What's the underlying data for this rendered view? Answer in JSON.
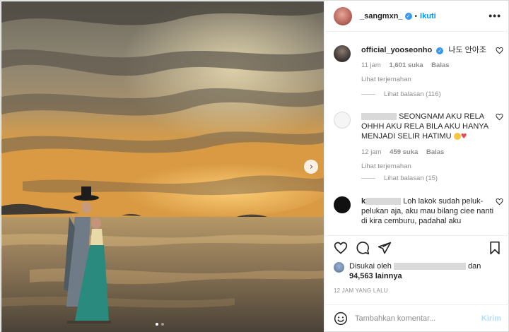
{
  "post": {
    "author": "_sangmxn_",
    "dot": "•",
    "follow_label": "Ikuti",
    "more_label": "•••"
  },
  "comments": [
    {
      "user": "official_yooseonho",
      "text": "나도 안아조",
      "time": "11 jam",
      "likes": "1,601 suka",
      "reply_label": "Balas",
      "translate_label": "Lihat terjemahan",
      "view_replies": "Lihat balasan (116)"
    },
    {
      "user": "",
      "text": "SEONGNAM AKU RELA OHHH AKU RELA BILA AKU HANYA MENJADI SELIR HATIMU",
      "time": "12 jam",
      "likes": "459 suka",
      "reply_label": "Balas",
      "translate_label": "Lihat terjemahan",
      "view_replies": "Lihat balasan (15)"
    },
    {
      "user": "",
      "user_initial": "k",
      "text": "Loh lakok sudah peluk-pelukan aja, aku mau bilang ciee nanti di kira cemburu, padahal aku"
    }
  ],
  "likes_block": {
    "prefix": "Disukai oleh",
    "suffix": "dan",
    "count": "94,563 lainnya"
  },
  "timestamp": "12 JAM YANG LALU",
  "composer": {
    "placeholder": "Tambahkan komentar...",
    "post_label": "Kirim"
  },
  "colors": {
    "link": "#0095f6",
    "verified": "#3897f0",
    "post_disabled": "#b2dffc",
    "heart": "#ed4956"
  },
  "icons": [
    "verified-badge-icon",
    "heart-icon",
    "comment-icon",
    "share-icon",
    "bookmark-icon",
    "emoji-icon",
    "chevron-right-icon"
  ]
}
